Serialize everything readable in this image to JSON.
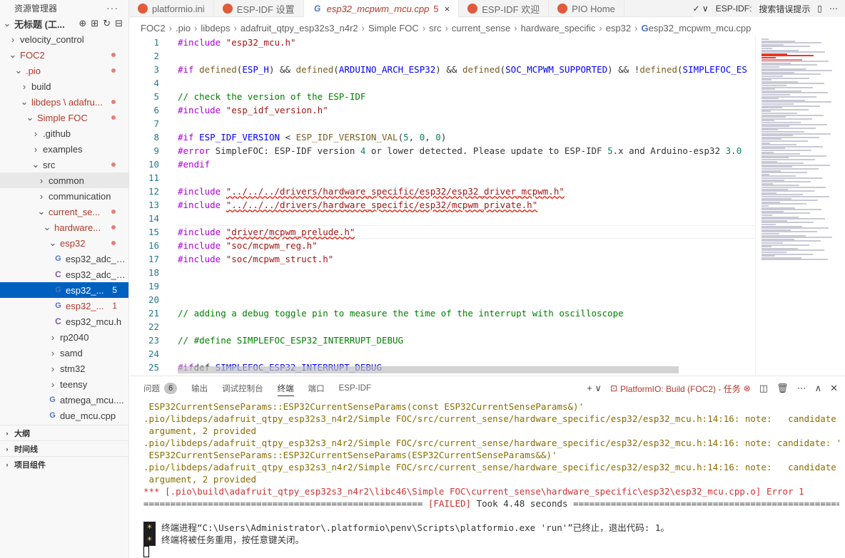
{
  "sidebar": {
    "title": "资源管理器",
    "more": "···",
    "tree": [
      {
        "label": "无标题 (工...",
        "level": 0,
        "chev": "∨",
        "bold": true
      },
      {
        "label": "velocity_control",
        "level": 1,
        "chev": ">"
      },
      {
        "label": "FOC2",
        "level": 1,
        "chev": "∨",
        "modified": true
      },
      {
        "label": ".pio",
        "level": 2,
        "chev": "∨",
        "modified": true
      },
      {
        "label": "build",
        "level": 3,
        "chev": ">"
      },
      {
        "label": "libdeps \\ adafru...",
        "level": 3,
        "chev": "∨",
        "modified": true
      },
      {
        "label": "Simple FOC",
        "level": 4,
        "chev": "∨",
        "modified": true
      },
      {
        "label": ".github",
        "level": 5,
        "chev": ">"
      },
      {
        "label": "examples",
        "level": 5,
        "chev": ">"
      },
      {
        "label": "src",
        "level": 5,
        "chev": "∨",
        "dotplain": true
      },
      {
        "label": "common",
        "level": 6,
        "chev": ">",
        "hover": true
      },
      {
        "label": "communication",
        "level": 6,
        "chev": ">"
      },
      {
        "label": "current_se...",
        "level": 6,
        "chev": "∨",
        "modified": true
      },
      {
        "label": "hardware...",
        "level": 7,
        "chev": "∨",
        "modified": true
      },
      {
        "label": "esp32",
        "level": 8,
        "chev": "∨",
        "modified": true
      },
      {
        "label": "esp32_adc_d...",
        "level": 9,
        "icon": "C+",
        "iconClass": "cpp"
      },
      {
        "label": "esp32_adc_d...",
        "level": 9,
        "icon": "C",
        "iconClass": "c"
      },
      {
        "label": "esp32_...",
        "level": 9,
        "icon": "C+",
        "iconClass": "cpp",
        "selected": true,
        "badge": "5"
      },
      {
        "label": "esp32_...",
        "level": 9,
        "icon": "C+",
        "iconClass": "cpp",
        "modified": true,
        "badge": "1"
      },
      {
        "label": "esp32_mcu.h",
        "level": 9,
        "icon": "C",
        "iconClass": "h"
      },
      {
        "label": "rp2040",
        "level": 8,
        "chev": ">"
      },
      {
        "label": "samd",
        "level": 8,
        "chev": ">"
      },
      {
        "label": "stm32",
        "level": 8,
        "chev": ">"
      },
      {
        "label": "teensy",
        "level": 8,
        "chev": ">"
      },
      {
        "label": "atmega_mcu....",
        "level": 8,
        "icon": "C+",
        "iconClass": "cpp"
      },
      {
        "label": "due_mcu.cpp",
        "level": 8,
        "icon": "C+",
        "iconClass": "cpp"
      }
    ],
    "sections": [
      "大纲",
      "时间线",
      "项目组件"
    ]
  },
  "tabs": [
    {
      "label": "platformio.ini",
      "icon": "pio"
    },
    {
      "label": "ESP-IDF 设置",
      "icon": "pio"
    },
    {
      "label": "esp32_mcpwm_mcu.cpp",
      "icon": "cpp",
      "active": true,
      "count": "5",
      "close": "×"
    },
    {
      "label": "ESP-IDF 欢迎",
      "icon": "pio"
    },
    {
      "label": "PIO Home",
      "icon": "pio"
    }
  ],
  "tab_right": {
    "check": "✓ ∨",
    "label": "ESP-IDF:",
    "hint": "搜索错误提示"
  },
  "breadcrumb": [
    "FOC2",
    ".pio",
    "libdeps",
    "adafruit_qtpy_esp32s3_n4r2",
    "Simple FOC",
    "src",
    "current_sense",
    "hardware_specific",
    "esp32",
    "esp32_mcpwm_mcu.cpp"
  ],
  "editor": {
    "lines": [
      {
        "n": "1",
        "t": "#include \"esp32_mcu.h\""
      },
      {
        "n": "2",
        "t": ""
      },
      {
        "n": "3",
        "t": "#if defined(ESP_H) && defined(ARDUINO_ARCH_ESP32) && defined(SOC_MCPWM_SUPPORTED) && !defined(SIMPLEFOC_ES"
      },
      {
        "n": "4",
        "t": ""
      },
      {
        "n": "5",
        "t": "// check the version of the ESP-IDF"
      },
      {
        "n": "6",
        "t": "#include \"esp_idf_version.h\""
      },
      {
        "n": "7",
        "t": ""
      },
      {
        "n": "8",
        "t": "#if ESP_IDF_VERSION < ESP_IDF_VERSION_VAL(5, 0, 0)"
      },
      {
        "n": "9",
        "t": "#error SimpleFOC: ESP-IDF version 4 or lower detected. Please update to ESP-IDF 5.x and Arduino-esp32 3.0"
      },
      {
        "n": "10",
        "t": "#endif"
      },
      {
        "n": "11",
        "t": ""
      },
      {
        "n": "12",
        "t": "#include \"../../../drivers/hardware_specific/esp32/esp32_driver_mcpwm.h\""
      },
      {
        "n": "13",
        "t": "#include \"../../../drivers/hardware_specific/esp32/mcpwm_private.h\""
      },
      {
        "n": "14",
        "t": ""
      },
      {
        "n": "15",
        "t": "#include \"driver/mcpwm_prelude.h\""
      },
      {
        "n": "16",
        "t": "#include \"soc/mcpwm_reg.h\""
      },
      {
        "n": "17",
        "t": "#include \"soc/mcpwm_struct.h\""
      },
      {
        "n": "18",
        "t": ""
      },
      {
        "n": "19",
        "t": ""
      },
      {
        "n": "20",
        "t": ""
      },
      {
        "n": "21",
        "t": "// adding a debug toggle pin to measure the time of the interrupt with oscilloscope"
      },
      {
        "n": "22",
        "t": ""
      },
      {
        "n": "23",
        "t": "// #define SIMPLEFOC_ESP32_INTERRUPT_DEBUG"
      },
      {
        "n": "24",
        "t": ""
      },
      {
        "n": "25",
        "t": "#ifdef SIMPLEFOC_ESP32_INTERRUPT_DEBUG"
      }
    ]
  },
  "panel": {
    "tabs": [
      {
        "label": "问题",
        "count": "6"
      },
      {
        "label": "输出"
      },
      {
        "label": "调试控制台"
      },
      {
        "label": "终端",
        "active": true
      },
      {
        "label": "端口"
      },
      {
        "label": "ESP-IDF"
      }
    ],
    "task": "PlatformIO: Build (FOC2) - 任务",
    "terminal": [
      {
        "t": " ESP32CurrentSenseParams::ESP32CurrentSenseParams(const ESP32CurrentSenseParams&)'",
        "c": "warn"
      },
      {
        "t": ".pio/libdeps/adafruit_qtpy_esp32s3_n4r2/Simple FOC/src/current_sense/hardware_specific/esp32/esp32_mcu.h:14:16: note:   candidate expects 1",
        "c": "warn"
      },
      {
        "t": " argument, 2 provided",
        "c": "warn"
      },
      {
        "t": ".pio/libdeps/adafruit_qtpy_esp32s3_n4r2/Simple FOC/src/current_sense/hardware_specific/esp32/esp32_mcu.h:14:16: note: candidate: 'constexpr",
        "c": "warn"
      },
      {
        "t": " ESP32CurrentSenseParams::ESP32CurrentSenseParams(ESP32CurrentSenseParams&&)'",
        "c": "warn"
      },
      {
        "t": ".pio/libdeps/adafruit_qtpy_esp32s3_n4r2/Simple FOC/src/current_sense/hardware_specific/esp32/esp32_mcu.h:14:16: note:   candidate expects 1",
        "c": "warn"
      },
      {
        "t": " argument, 2 provided",
        "c": "warn"
      },
      {
        "t": "*** [.pio\\build\\adafruit_qtpy_esp32s3_n4r2\\libc46\\Simple FOC\\current_sense\\hardware_specific\\esp32\\esp32_mcu.cpp.o] Error 1",
        "c": "err"
      },
      {
        "t": "==================================================== [FAILED] Took 4.48 seconds ====================================================",
        "c": "plain"
      },
      {
        "t": "",
        "c": "blank"
      },
      {
        "t": "终端进程“C:\\Users\\Administrator\\.platformio\\penv\\Scripts\\platformio.exe 'run'”已终止，退出代码: 1。",
        "c": "plain",
        "star": "*"
      },
      {
        "t": "终端将被任务重用，按任意键关闭。",
        "c": "plain",
        "star": "*"
      }
    ]
  },
  "colors": {
    "accent": "#0060c0",
    "error": "#cd3131",
    "modified": "#b1392b"
  }
}
